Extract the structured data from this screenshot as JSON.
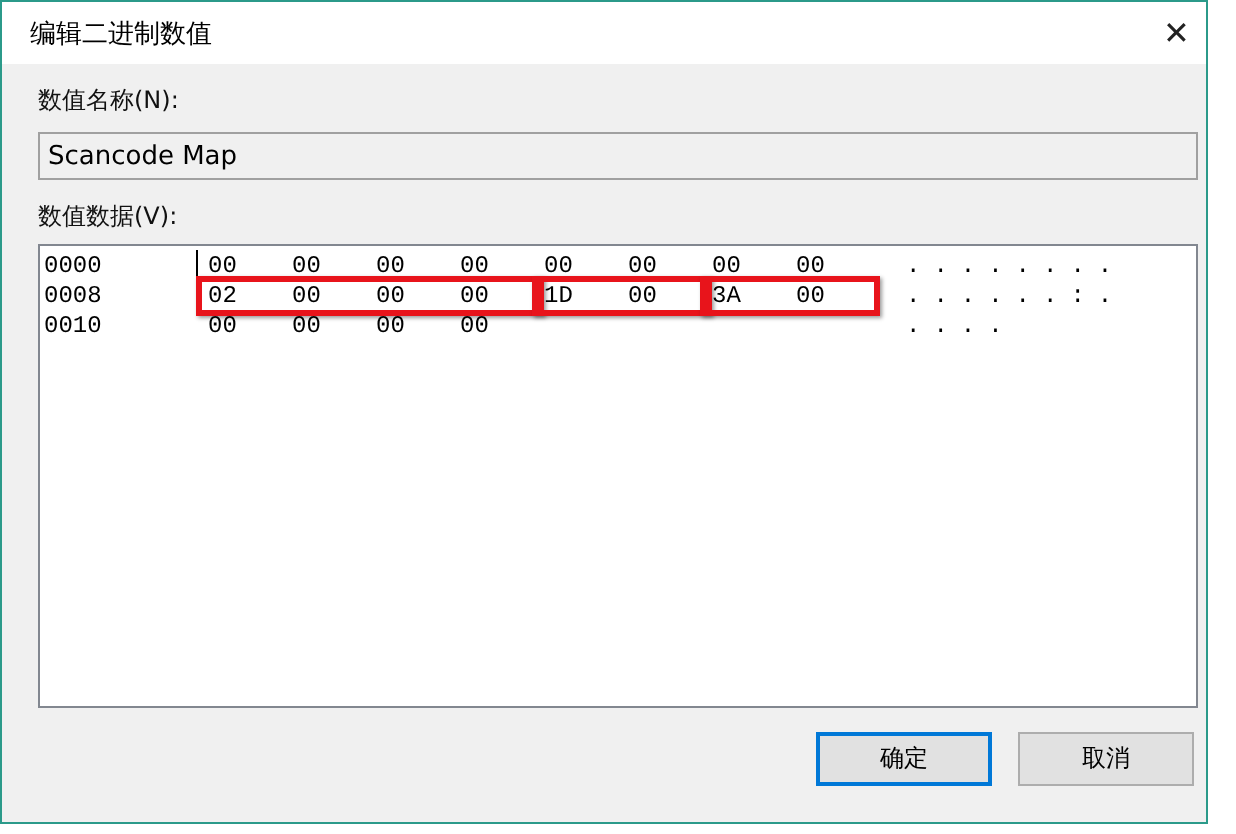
{
  "window": {
    "title": "编辑二进制数值",
    "close": "✕"
  },
  "value_name": {
    "label": "数值名称(N):",
    "value": "Scancode Map"
  },
  "value_data": {
    "label": "数值数据(V):",
    "rows": [
      {
        "address": "0000",
        "groups": [
          {
            "highlighted": false,
            "bytes": [
              "00",
              "00",
              "00",
              "00",
              "00",
              "00",
              "00",
              "00"
            ]
          }
        ],
        "ascii": "........"
      },
      {
        "address": "0008",
        "groups": [
          {
            "highlighted": true,
            "bytes": [
              "02",
              "00",
              "00",
              "00"
            ]
          },
          {
            "highlighted": true,
            "bytes": [
              "1D",
              "00"
            ]
          },
          {
            "highlighted": true,
            "bytes": [
              "3A",
              "00"
            ]
          }
        ],
        "ascii": "......:."
      },
      {
        "address": "0010",
        "groups": [
          {
            "highlighted": false,
            "bytes": [
              "00",
              "00",
              "00",
              "00"
            ]
          }
        ],
        "ascii": "...."
      }
    ]
  },
  "buttons": [
    {
      "label": "确定",
      "default": true
    },
    {
      "label": "取消",
      "default": false
    }
  ]
}
